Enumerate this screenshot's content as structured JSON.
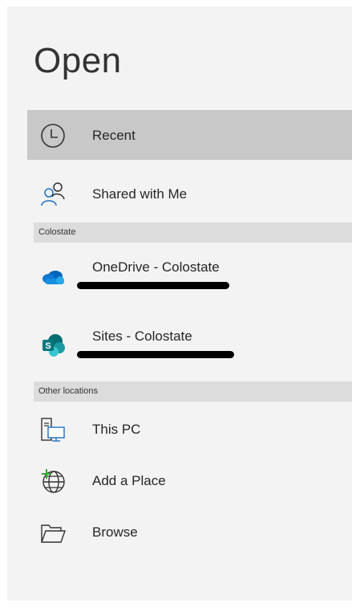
{
  "page": {
    "title": "Open"
  },
  "items": {
    "recent": {
      "label": "Recent",
      "icon": "clock-icon"
    },
    "shared": {
      "label": "Shared with Me",
      "icon": "people-icon"
    }
  },
  "sections": {
    "colostate": {
      "label": "Colostate"
    },
    "other": {
      "label": "Other locations"
    }
  },
  "cloud": {
    "onedrive": {
      "label": "OneDrive - Colostate",
      "icon": "onedrive-icon",
      "redacted": true
    },
    "sites": {
      "label": "Sites - Colostate",
      "icon": "sharepoint-icon",
      "redacted": true
    }
  },
  "locations": {
    "this_pc": {
      "label": "This PC",
      "icon": "computer-icon"
    },
    "add_place": {
      "label": "Add a Place",
      "icon": "globe-add-icon"
    },
    "browse": {
      "label": "Browse",
      "icon": "folder-open-icon"
    }
  },
  "colors": {
    "selected_bg": "#c8c8c8",
    "panel_bg": "#f3f3f3",
    "section_bg": "#dcdcdc",
    "onedrive_blue": "#0f6cbd",
    "sharepoint_teal": "#038387",
    "add_green": "#33a833"
  }
}
